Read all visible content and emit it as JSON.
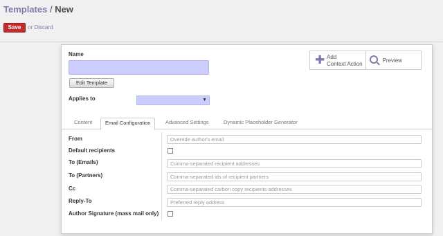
{
  "breadcrumb": {
    "parent": "Templates",
    "sep": " / ",
    "current": "New"
  },
  "toolbar": {
    "save_label": "Save",
    "or_label": "or",
    "discard_label": "Discard"
  },
  "form": {
    "name_label": "Name",
    "edit_template_label": "Edit Template",
    "applies_to_label": "Applies to",
    "add_context_line1": "Add",
    "add_context_line2": "Context Action",
    "preview_label": "Preview"
  },
  "tabs": [
    {
      "label": "Content"
    },
    {
      "label": "Email Configuration"
    },
    {
      "label": "Advanced Settings"
    },
    {
      "label": "Dynamic Placeholder Generator"
    }
  ],
  "fields": {
    "from": {
      "label": "From",
      "placeholder": "Override author's email"
    },
    "default_recipients": {
      "label": "Default recipients"
    },
    "to_emails": {
      "label": "To (Emails)",
      "placeholder": "Comma-separated recipient addresses"
    },
    "to_partners": {
      "label": "To (Partners)",
      "placeholder": "Comma-separated ids of recipient partners"
    },
    "cc": {
      "label": "Cc",
      "placeholder": "Comma-separated carbon copy recipients addresses"
    },
    "reply_to": {
      "label": "Reply-To",
      "placeholder": "Preferred reply address"
    },
    "author_signature": {
      "label": "Author Signature (mass mail only)"
    }
  },
  "colors": {
    "accent": "#7c7bad",
    "save": "#c02c2c",
    "required": "#ccccff"
  }
}
